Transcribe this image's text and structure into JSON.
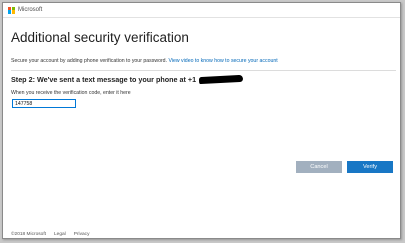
{
  "header": {
    "brand": "Microsoft",
    "logo_colors": [
      "#f25022",
      "#7fba00",
      "#00a4ef",
      "#ffb900"
    ]
  },
  "main": {
    "title": "Additional security verification",
    "intro_text": "Secure your account by adding phone verification to your password.",
    "intro_link": "View video to know how to secure your account",
    "step_text": "Step 2: We've sent a text message to your phone at +1",
    "hint_text": "When you receive the verification code, enter it here",
    "code_value": "147758"
  },
  "actions": {
    "cancel_label": "Cancel",
    "verify_label": "Verify"
  },
  "footer": {
    "copyright": "©2018 Microsoft",
    "legal": "Legal",
    "privacy": "Privacy"
  },
  "colors": {
    "accent": "#0078d7",
    "verify_button": "#1877c5",
    "cancel_button": "#a2b0bf"
  }
}
